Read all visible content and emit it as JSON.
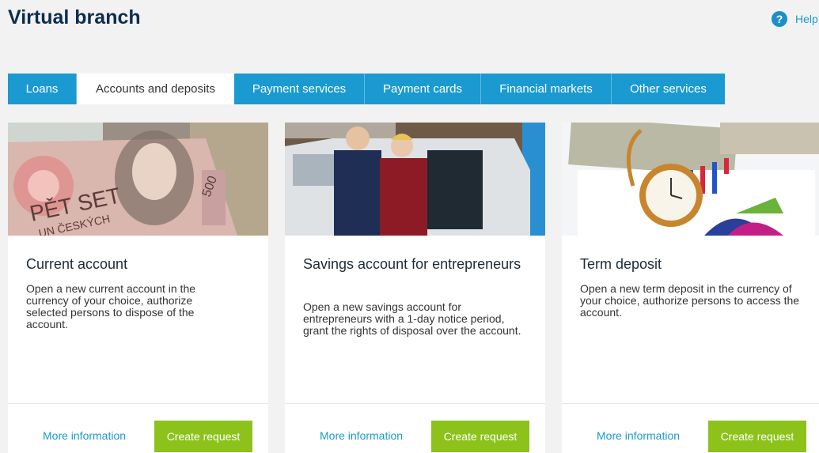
{
  "header": {
    "title": "Virtual branch",
    "help_label": "Help"
  },
  "tabs": [
    {
      "label": "Loans"
    },
    {
      "label": "Accounts and deposits",
      "active": true
    },
    {
      "label": "Payment services"
    },
    {
      "label": "Payment cards"
    },
    {
      "label": "Financial markets"
    },
    {
      "label": "Other services"
    }
  ],
  "cards": [
    {
      "title": "Current account",
      "description": "Open a new current account in the currency of your choice, authorize selected persons to dispose of the account.",
      "more_label": "More information",
      "button_label": "Create request",
      "image_text": [
        "PĚT SET",
        "UN ČESKÝCH",
        "500"
      ]
    },
    {
      "title": "Savings account for entrepreneurs",
      "description": "Open a new savings account for entrepreneurs with a 1-day notice period, grant the rights of disposal over the account.",
      "more_label": "More information",
      "button_label": "Create request"
    },
    {
      "title": "Term deposit",
      "description": "Open a new term deposit in the currency of your choice, authorize persons to access the account.",
      "more_label": "More information",
      "button_label": "Create request"
    }
  ],
  "colors": {
    "accent": "#1a9ad0",
    "button": "#8cc21a",
    "title": "#0b2e4f"
  }
}
